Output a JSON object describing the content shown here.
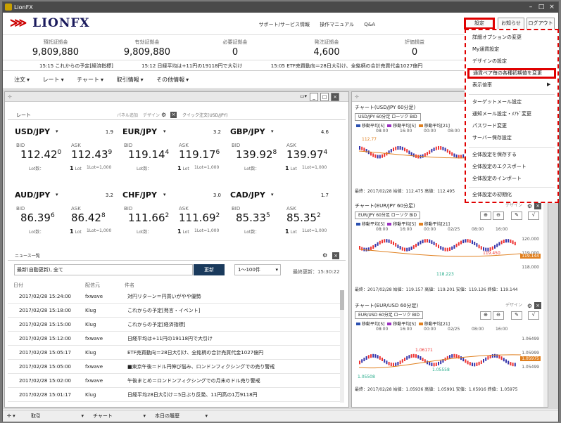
{
  "window": {
    "title": "LionFX"
  },
  "header": {
    "logo": "LIONFX",
    "links": [
      "サポート/サービス情報",
      "操作マニュアル",
      "Q&A"
    ],
    "settings": "設定",
    "notice": "お知らせ",
    "logout": "ログアウト"
  },
  "summary": [
    {
      "label": "預託証拠金",
      "value": "9,809,880"
    },
    {
      "label": "有効証拠金",
      "value": "9,809,880"
    },
    {
      "label": "必要証拠金",
      "value": "0"
    },
    {
      "label": "発注証拠金",
      "value": "4,600"
    },
    {
      "label": "評価損益",
      "value": "0"
    }
  ],
  "ticker": [
    "15:15  これからの予定[経済指標]",
    "15:12  日経平均は+11円の19118円で大引け",
    "15:05  ETF売買動向＝28日大引け、全銘柄の合計売買代金1027億円"
  ],
  "menu": [
    "注文",
    "レート",
    "チャート",
    "取引情報",
    "その他情報"
  ],
  "rate_panel": {
    "title": "レート",
    "add": "パネル追加",
    "design": "デザイン",
    "quick": "クイック注文(USD/JPY)"
  },
  "rates": [
    {
      "pair": "USD/JPY",
      "spread": "1.9",
      "bid_main": "112.42",
      "bid_sup": "0",
      "ask_main": "112.43",
      "ask_sup": "9"
    },
    {
      "pair": "EUR/JPY",
      "spread": "3.2",
      "bid_main": "119.14",
      "bid_sup": "4",
      "ask_main": "119.17",
      "ask_sup": "6"
    },
    {
      "pair": "GBP/JPY",
      "spread": "4.6",
      "bid_main": "139.92",
      "bid_sup": "8",
      "ask_main": "139.97",
      "ask_sup": "4"
    },
    {
      "pair": "AUD/JPY",
      "spread": "3.2",
      "bid_main": "86.39",
      "bid_sup": "6",
      "ask_main": "86.42",
      "ask_sup": "8"
    },
    {
      "pair": "CHF/JPY",
      "spread": "3.0",
      "bid_main": "111.66",
      "bid_sup": "2",
      "ask_main": "111.69",
      "ask_sup": "2"
    },
    {
      "pair": "CAD/JPY",
      "spread": "1.7",
      "bid_main": "85.33",
      "bid_sup": "5",
      "ask_main": "85.35",
      "ask_sup": "2"
    }
  ],
  "rate_labels": {
    "bid": "BID",
    "ask": "ASK",
    "lot_label": "Lot数：",
    "lot": "1",
    "lot_unit": "Lot",
    "lot_note": "1Lot=1,000"
  },
  "news": {
    "title": "ニュース一覧",
    "filter": "最新(自動更新), 全て",
    "update": "更新",
    "range": "1～100件",
    "last_update": "最終更新：15:30:22",
    "cols": [
      "日付",
      "配信元",
      "件名"
    ],
    "rows": [
      [
        "2017/02/28 15:24:00",
        "fxwave",
        "対円リターン＝円買いがやや優勢"
      ],
      [
        "2017/02/28 15:18:00",
        "Klug",
        "これからの予定[発言・イベント]"
      ],
      [
        "2017/02/28 15:15:00",
        "Klug",
        "これからの予定[経済指標]"
      ],
      [
        "2017/02/28 15:12:00",
        "fxwave",
        "日経平均は+11円の19118円で大引け"
      ],
      [
        "2017/02/28 15:05:17",
        "Klug",
        "ETF売買動向＝28日大引け、全銘柄の合計売買代金1027億円"
      ],
      [
        "2017/02/28 15:05:00",
        "fxwave",
        "■東京午後＝ドル円伸び悩み、ロンドンフィクシングでの売り警戒"
      ],
      [
        "2017/02/28 15:02:00",
        "fxwave",
        "午後まとめ＝ロンドンフィクシングでの月末のドル売り警戒"
      ],
      [
        "2017/02/28 15:01:17",
        "Klug",
        "日経平均28日大引け＝5日ぶり反発、11円高の1万9118円"
      ]
    ]
  },
  "charts": [
    {
      "title": "チャート(USD/JPY 60分足)",
      "box": "USD/JPY 60分足 ローソク BID",
      "legend": [
        "移動平均[5]",
        "移動平均[5]",
        "移動平均[21]"
      ],
      "ticks": [
        "08:00",
        "16:00",
        "00:00",
        "08:00",
        "16:00",
        "02/25",
        "08:00"
      ],
      "label": "112.77",
      "footer": "最終：2017/02/28  始値：112.475  高値：112.495"
    },
    {
      "title": "チャート(EUR/JPY 60分足)",
      "design": "デザイン",
      "box": "EUR/JPY 60分足 ローソク BID",
      "legend": [
        "移動平均[5]",
        "移動平均[5]",
        "移動平均[21]"
      ],
      "ticks": [
        "08:00",
        "16:00",
        "00:00",
        "02/25",
        "08:00",
        "16:00"
      ],
      "yticks": [
        "120.000",
        "119.000",
        "118.000"
      ],
      "current": "119.144",
      "hi": "119.450",
      "lo": "118.223",
      "footer": "最終：2017/02/28  始値：119.157  高値：119.201  安値：119.126  終値：119.144"
    },
    {
      "title": "チャート(EUR/USD 60分足)",
      "design": "デザイン",
      "box": "EUR/USD 60分足 ローソク BID",
      "legend": [
        "移動平均[5]",
        "移動平均[5]",
        "移動平均[21]"
      ],
      "ticks": [
        "08:00",
        "16:00",
        "00:00",
        "02/25",
        "08:00",
        "16:00"
      ],
      "yticks": [
        "1.06499",
        "1.05999",
        "1.05499"
      ],
      "current": "1.05975",
      "hi": "1.06171",
      "mid": "1.05558",
      "lo": "1.05508",
      "footer": "最終：2017/02/28  始値：1.05936  高値：1.05991  安値：1.05916  終値：1.05975"
    }
  ],
  "status": [
    "取引",
    "チャート",
    "本日の履歴"
  ],
  "dropdown": {
    "items": [
      "詳細オプションの変更",
      "My通貨設定",
      "デザインの設定",
      "通貨ペア毎の各種初期値を変更",
      "表示倍率",
      "ターゲットメール設定",
      "通知メール設定・ﾒｱﾄﾞ変更",
      "パスワード変更",
      "サーバー保存設定",
      "全体設定を保存する",
      "全体設定のエクスポート",
      "全体設定のインポート",
      "全体設定の初期化"
    ]
  },
  "colors": {
    "accent": "#e00000",
    "dark": "#1a3a5c"
  }
}
